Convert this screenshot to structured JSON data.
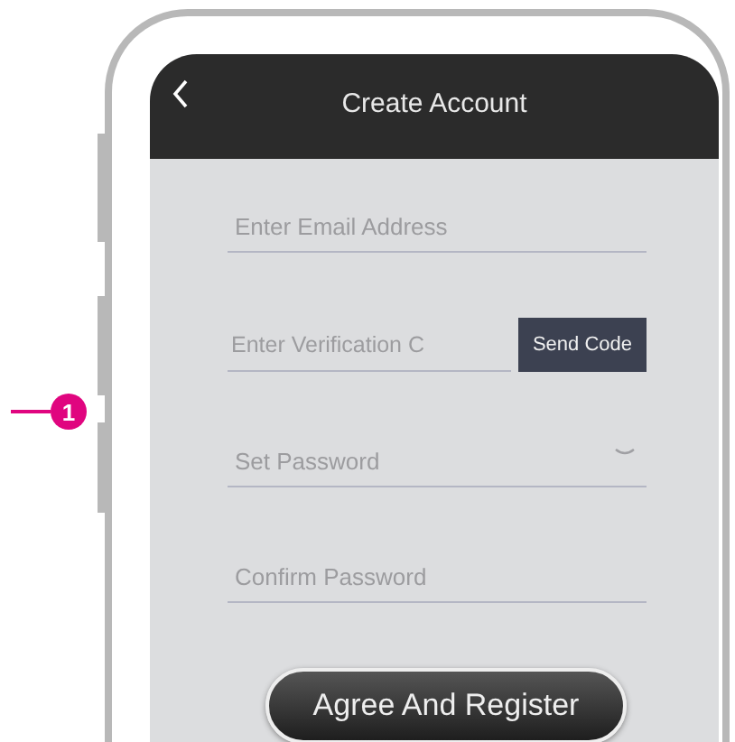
{
  "callout": {
    "number": "1"
  },
  "header": {
    "title": "Create Account"
  },
  "fields": [
    {
      "kind": "text",
      "placeholder": "Enter Email Address"
    },
    {
      "kind": "code",
      "placeholder": "Enter Verification C",
      "button": "Send Code"
    },
    {
      "kind": "password",
      "placeholder": "Set Password"
    },
    {
      "kind": "text",
      "placeholder": "Confirm Password"
    }
  ],
  "submit": "Agree And Register"
}
